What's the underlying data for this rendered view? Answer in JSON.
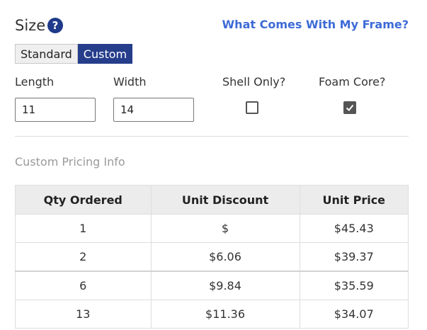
{
  "header": {
    "size_label": "Size",
    "help_icon": "?",
    "frame_link": "What Comes With My Frame?"
  },
  "size_toggle": {
    "standard_label": "Standard",
    "custom_label": "Custom",
    "selected": "Custom"
  },
  "fields": {
    "length": {
      "label": "Length",
      "value": "11"
    },
    "width": {
      "label": "Width",
      "value": "14"
    },
    "shell_only": {
      "label": "Shell Only?",
      "checked": false
    },
    "foam_core": {
      "label": "Foam Core?",
      "checked": true
    }
  },
  "pricing": {
    "title": "Custom Pricing Info",
    "columns": [
      "Qty Ordered",
      "Unit Discount",
      "Unit Price"
    ],
    "rows": [
      [
        "1",
        "$",
        "$45.43"
      ],
      [
        "2",
        "$6.06",
        "$39.37"
      ],
      [
        "6",
        "$9.84",
        "$35.59"
      ],
      [
        "13",
        "$11.36",
        "$34.07"
      ]
    ]
  },
  "colors": {
    "link": "#3d6bd6",
    "toggle_selected": "#253d8b",
    "help_icon": "#1f3a8a"
  }
}
